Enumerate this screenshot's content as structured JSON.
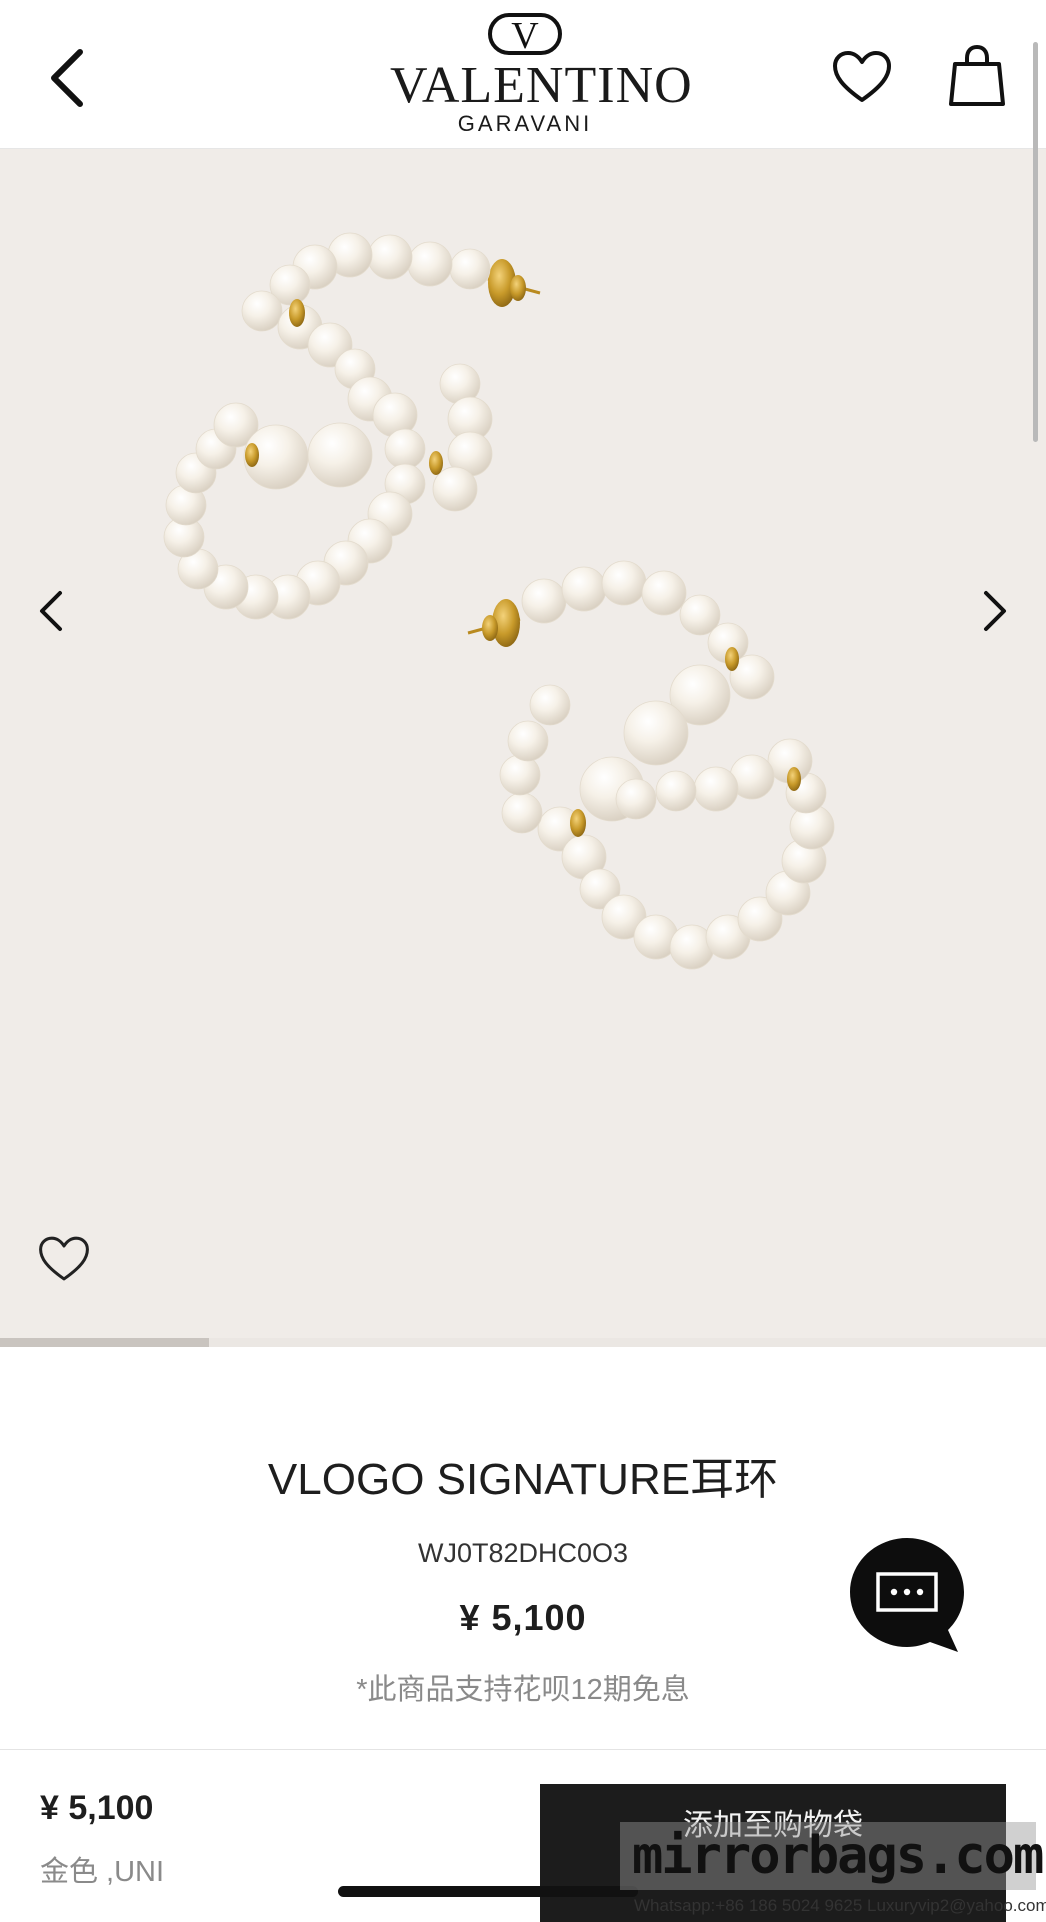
{
  "header": {
    "brand": "VALENTINO",
    "brand_sub": "GARAVANI",
    "monogram": "V",
    "icons": [
      "back-icon",
      "heart-icon",
      "shopping-bag-icon"
    ]
  },
  "gallery": {
    "icons": [
      "chevron-left-icon",
      "chevron-right-icon",
      "heart-icon"
    ],
    "image_progress": 0.2,
    "colors": {
      "background": "#f0ece8",
      "pearl": "#f4efe6",
      "gold": "#c89a2a"
    }
  },
  "product": {
    "title": "VLOGO SIGNATURE耳环",
    "sku": "WJ0T82DHC0O3",
    "price": "¥ 5,100",
    "promo": "*此商品支持花呗12期免息"
  },
  "chat": {
    "icon": "chat-bubble-icon"
  },
  "bottom_bar": {
    "price": "¥ 5,100",
    "variant": "金色 ,UNI",
    "add_to_bag": "添加至购物袋"
  },
  "watermark": {
    "site": "mirrorbags.com",
    "contact": "Whatsapp:+86 186 5024 9625   Luxuryvip2@yahoo.com"
  }
}
